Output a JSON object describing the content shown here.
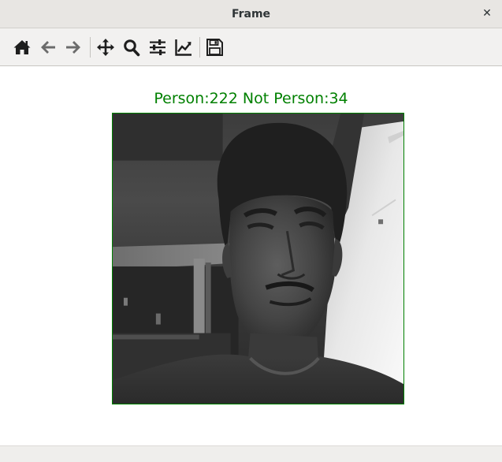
{
  "window": {
    "title": "Frame",
    "close_glyph": "✕"
  },
  "toolbar": {
    "items": [
      {
        "icon": "home-icon"
      },
      {
        "icon": "arrow-left-icon"
      },
      {
        "icon": "arrow-right-icon"
      },
      {
        "icon": "move-icon"
      },
      {
        "icon": "zoom-icon"
      },
      {
        "icon": "sliders-icon"
      },
      {
        "icon": "chart-line-icon"
      },
      {
        "icon": "save-icon"
      }
    ],
    "icon_color": "#1e1e1e",
    "disabled_color": "#6b6b6b"
  },
  "figure": {
    "title": "Person:222 Not Person:34",
    "title_color": "#008000",
    "frame_border_color": "#008000"
  }
}
